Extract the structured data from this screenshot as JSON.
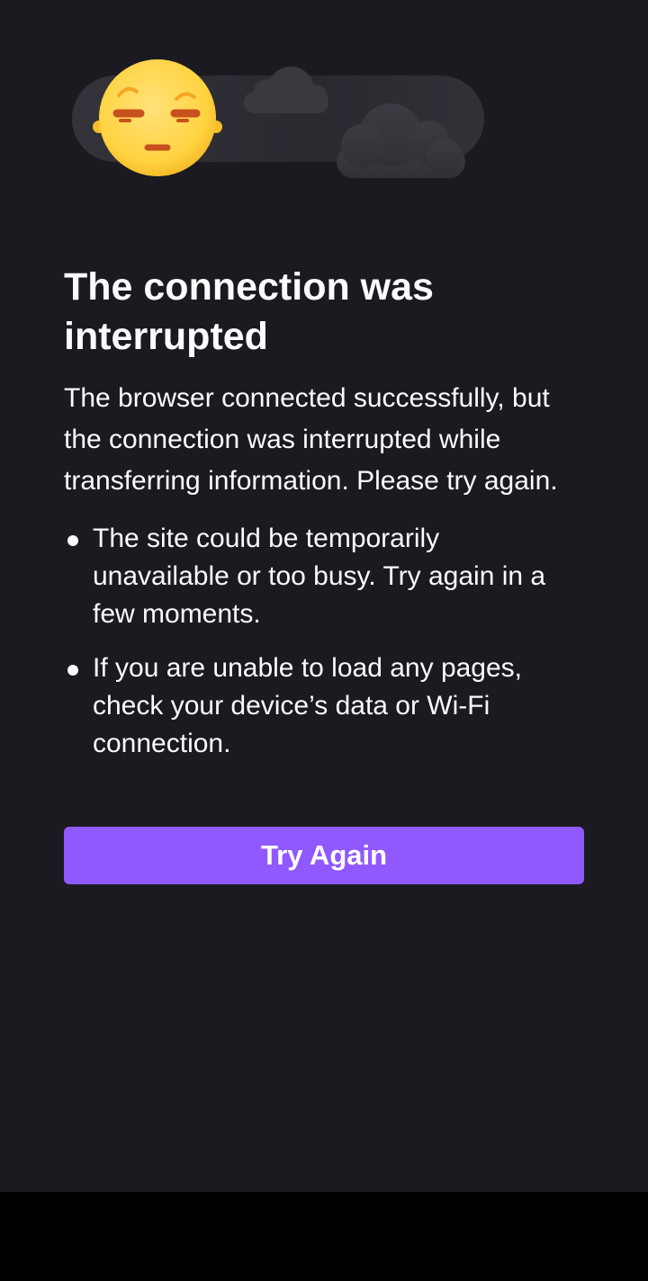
{
  "error_page": {
    "title": "The connection was interrupted",
    "description": "The browser connected successfully, but the connection was interrupted while transferring information. Please try again.",
    "tips": [
      "The site could be temporarily unavailable or too busy. Try again in a few moments.",
      "If you are unable to load any pages, check your device’s data or Wi-Fi connection."
    ],
    "try_again_label": "Try Again"
  },
  "colors": {
    "background": "#1b1a20",
    "text": "#fbfbfe",
    "button": "#9059ff",
    "emoji_face": "#ffd94f"
  },
  "icons": {
    "illustration": "unamused-face-with-clouds-icon"
  }
}
